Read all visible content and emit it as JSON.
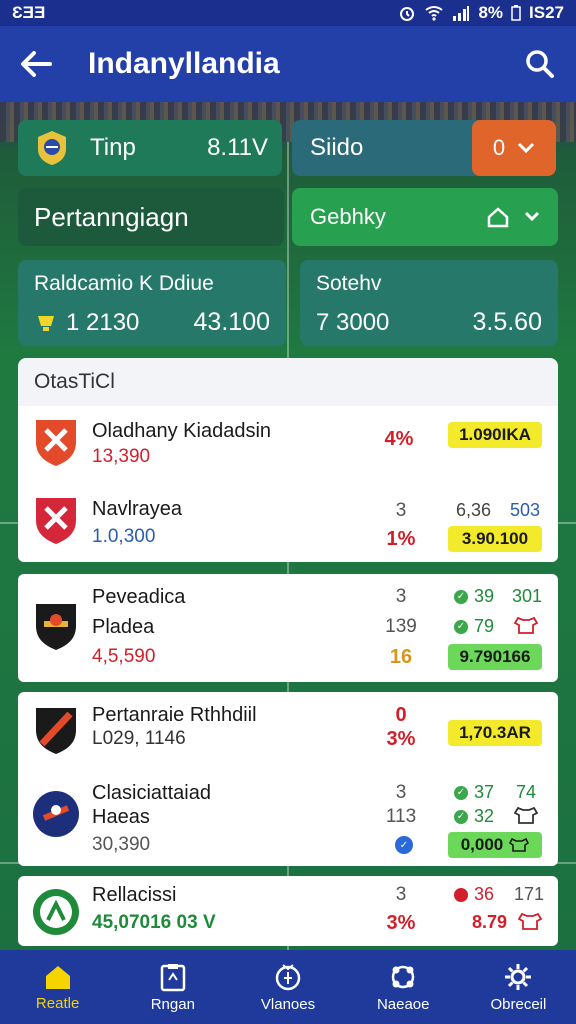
{
  "status_bar": {
    "left": "ƐƎƎ",
    "battery": "8%",
    "time": "ƖS27"
  },
  "app_bar": {
    "title": "Indanyllandia"
  },
  "summary": {
    "tip": {
      "label": "Tinp",
      "value": "8.11V"
    },
    "stato": {
      "label": "Siido",
      "pill_value": "0"
    },
    "pertandingan": "Pertanngiagn",
    "filter": {
      "label": "Gebhky"
    },
    "stat_left": {
      "title": "Raldcamio K Ddiue",
      "value_a": "1 2130",
      "value_b": "43.100"
    },
    "stat_right": {
      "title": "Sotehv",
      "value_a": "7 3000",
      "value_b": "3.5.60"
    }
  },
  "list_header": "OtasTiCl",
  "rows": [
    {
      "name": "Oladhany Kiadadsin",
      "sub": "13,390",
      "mid": "",
      "pct": "4%",
      "odds": "1.090IKA"
    },
    {
      "name": "Navlrayea",
      "sub": "1.0,300",
      "mid": "3",
      "pct": "1%",
      "odds": "3.90.100",
      "extra_a": "6,36",
      "extra_b": "503"
    },
    {
      "name": "Peveadica",
      "name2": "Pladea",
      "sub": "4,5,590",
      "mid1": "3",
      "mid2": "139",
      "pct": "16",
      "m1": "39",
      "m1b": "301",
      "m2": "79",
      "odds": "9.790166"
    },
    {
      "name": "Pertanraie Rthhdiil",
      "sub": "L029, 1146",
      "mid": "0",
      "pct": "3%",
      "odds": "1,70.3AR"
    },
    {
      "name": "Clasiciattaiad",
      "name2": "Haeas",
      "sub": "30,390",
      "mid1": "3",
      "mid2": "113",
      "m1": "37",
      "m1b": "74",
      "m2": "32",
      "odds": "0,000"
    },
    {
      "name": "Rellacissi",
      "sub": "45,07016 03 V",
      "mid": "3",
      "pct": "3%",
      "m1": "36",
      "m1b": "171",
      "m2": "8.79"
    }
  ],
  "nav": [
    {
      "label": "Reatle",
      "icon": "home-icon"
    },
    {
      "label": "Rngan",
      "icon": "ticket-icon"
    },
    {
      "label": "Vlanoes",
      "icon": "medal-icon"
    },
    {
      "label": "Naeaoe",
      "icon": "group-icon"
    },
    {
      "label": "Obreceil",
      "icon": "settings-icon"
    }
  ],
  "colors": {
    "app_bar": "#2340a8",
    "accent_yellow": "#f2ea2a",
    "accent_green": "#27a050",
    "accent_orange": "#e0652a",
    "red": "#d21f2a"
  }
}
